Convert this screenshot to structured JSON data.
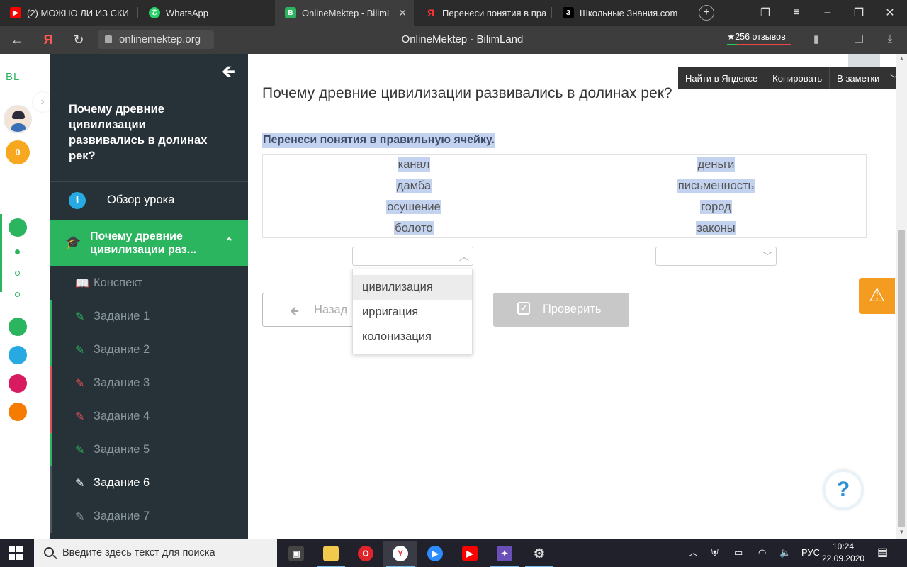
{
  "browser": {
    "tabs": [
      {
        "title": "(2) МОЖНО ЛИ ИЗ СКИ",
        "icon": "youtube-icon",
        "color": "#ff0000"
      },
      {
        "title": "WhatsApp",
        "icon": "whatsapp-icon",
        "color": "#25d366"
      },
      {
        "title": "OnlineMektep - BilimL",
        "icon": "onlinemektep-icon",
        "color": "#2cb55f"
      },
      {
        "title": "Перенеси понятия в пра",
        "icon": "yandex-icon",
        "color": "#ff3333"
      },
      {
        "title": "Школьные Знания.com",
        "icon": "znanija-icon",
        "color": "#000000"
      }
    ],
    "url": "onlinemektep.org",
    "page_title": "OnlineMektep - BilimLand",
    "reviews": "256 отзывов",
    "accent": "#2cb55f"
  },
  "rail": {
    "logo": "BL",
    "coins": "0"
  },
  "sidebar": {
    "course_title": "Почему древние цивилизации развивались в долинах рек?",
    "overview_label": "Обзор урока",
    "lesson_label": "Почему древние цивилизации раз...",
    "items": [
      {
        "label": "Конспект",
        "icon": "book-icon",
        "color": "#2cb55f"
      },
      {
        "label": "Задание 1",
        "icon": "edit-icon",
        "color": "#2cb55f"
      },
      {
        "label": "Задание 2",
        "icon": "edit-icon",
        "color": "#2cb55f"
      },
      {
        "label": "Задание 3",
        "icon": "edit-icon",
        "color": "#e0505a"
      },
      {
        "label": "Задание 4",
        "icon": "edit-icon",
        "color": "#e0505a"
      },
      {
        "label": "Задание 5",
        "icon": "edit-icon",
        "color": "#2cb55f"
      },
      {
        "label": "Задание 6",
        "icon": "edit-icon",
        "color": "#ffffff"
      },
      {
        "label": "Задание 7",
        "icon": "edit-icon",
        "color": "#8a979c"
      }
    ]
  },
  "main": {
    "question_title": "Почему древние цивилизации развивались в долинах рек?",
    "instruction": "Перенеси понятия в правильную ячейку.",
    "left_column": [
      "канал",
      "дамба",
      "осушение",
      "болото"
    ],
    "right_column": [
      "деньги",
      "письменность",
      "город",
      "законы"
    ],
    "dropdown_options": [
      "цивилизация",
      "ирригация",
      "колонизация"
    ],
    "back_label": "Назад",
    "check_label": "Проверить"
  },
  "context_menu": [
    "Найти в Яндексе",
    "Копировать",
    "В заметки"
  ],
  "taskbar": {
    "search_placeholder": "Введите здесь текст для поиска",
    "language": "РУС",
    "time": "10:24",
    "date": "22.09.2020"
  }
}
